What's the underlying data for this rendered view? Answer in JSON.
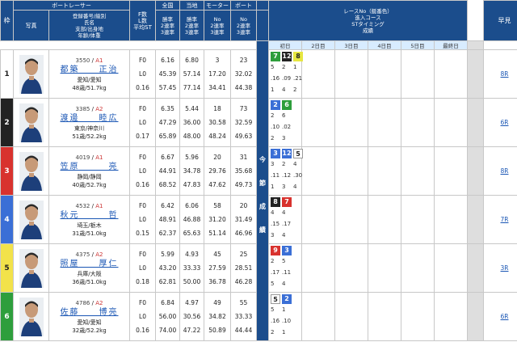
{
  "header": {
    "lane": "枠",
    "photo": "写真",
    "racer": "ボートレーサー",
    "info_lines": [
      "登録番号/級別",
      "氏名",
      "支部/出身地",
      "年齢/体重"
    ],
    "f_l_st": [
      "F数",
      "L数",
      "平均ST"
    ],
    "zenkoku": "全国",
    "touchi": "当地",
    "motor": "モーター",
    "boat": "ボート",
    "rates": [
      "勝率",
      "2連率",
      "3連率"
    ],
    "motor_sub": [
      "No",
      "2連率",
      "3連率"
    ],
    "race_title": [
      "レースNo（艇番色）",
      "進入コース",
      "STタイミング",
      "成績"
    ],
    "days": [
      "初日",
      "2日目",
      "3日目",
      "4日目",
      "5日目",
      "最終日"
    ],
    "haya": "早見",
    "konsetsu": [
      "今",
      "節",
      "成",
      "績"
    ]
  },
  "racers": [
    {
      "lane": "1",
      "lane_color": "#ffffff",
      "lane_text": "#222222",
      "reg": "3550",
      "cls": "A1",
      "name": "都築　　正治",
      "branch": "愛知/愛知",
      "age": "48歳/51.7kg",
      "f": "F0",
      "l": "L0",
      "st": "0.16",
      "zen": [
        "6.16",
        "45.39",
        "57.45"
      ],
      "tou": [
        "6.80",
        "57.14",
        "77.14"
      ],
      "mot": [
        "3",
        "17.20",
        "34.41"
      ],
      "boat": [
        "23",
        "32.02",
        "44.38"
      ],
      "d1": {
        "no": "7",
        "no_color": "#2e9e3c",
        "no_text": "#ffffff",
        "c2": "12",
        "c2_color": "#222222",
        "c2_text": "#ffffff",
        "c3": "8",
        "c3_color": "#e6e640",
        "c3_text": "#222222",
        "lines": [
          "5",
          ".16",
          "1"
        ],
        "l2": [
          "2",
          ".09",
          "4"
        ],
        "l3": [
          "1",
          ".21",
          "2"
        ]
      },
      "d2": null,
      "haya": "8R"
    },
    {
      "lane": "2",
      "lane_color": "#222222",
      "lane_text": "#ffffff",
      "reg": "3385",
      "cls": "A2",
      "name": "渡邊　　睦広",
      "branch": "東京/神奈川",
      "age": "51歳/52.2kg",
      "f": "F0",
      "l": "L0",
      "st": "0.17",
      "zen": [
        "6.35",
        "47.29",
        "65.89"
      ],
      "tou": [
        "5.44",
        "36.00",
        "48.00"
      ],
      "mot": [
        "18",
        "30.58",
        "48.24"
      ],
      "boat": [
        "73",
        "32.59",
        "49.63"
      ],
      "d1": {
        "no": "2",
        "no_color": "#3b6fd6",
        "no_text": "#ffffff",
        "c2": "6",
        "c2_color": "#2e9e3c",
        "c2_text": "#ffffff",
        "c3": "",
        "lines": [
          "2",
          ".10",
          "2"
        ],
        "l2": [
          "6",
          ".02",
          "3"
        ],
        "l3": [
          "",
          "",
          ""
        ]
      },
      "d2": null,
      "haya": "6R"
    },
    {
      "lane": "3",
      "lane_color": "#d8322e",
      "lane_text": "#ffffff",
      "reg": "4019",
      "cls": "A1",
      "name": "笠原　　　亮",
      "branch": "静岡/静岡",
      "age": "40歳/52.7kg",
      "f": "F0",
      "l": "L0",
      "st": "0.16",
      "zen": [
        "6.67",
        "44.91",
        "68.52"
      ],
      "tou": [
        "5.96",
        "34.78",
        "47.83"
      ],
      "mot": [
        "20",
        "29.76",
        "47.62"
      ],
      "boat": [
        "31",
        "35.68",
        "49.73"
      ],
      "d1": {
        "no": "3",
        "no_color": "#3b6fd6",
        "no_text": "#ffffff",
        "c2": "12",
        "c2_color": "#3b6fd6",
        "c2_text": "#ffffff",
        "c3": "5",
        "c3_color": "#ffffff",
        "c3_text": "#222222",
        "lines": [
          "3",
          ".11",
          "1"
        ],
        "l2": [
          "2",
          ".12",
          "3"
        ],
        "l3": [
          "4",
          ".30",
          "4"
        ]
      },
      "d2": null,
      "haya": "8R"
    },
    {
      "lane": "4",
      "lane_color": "#3b6fd6",
      "lane_text": "#ffffff",
      "reg": "4532",
      "cls": "A1",
      "name": "秋元　　　哲",
      "branch": "埼玉/栃木",
      "age": "31歳/51.0kg",
      "f": "F0",
      "l": "L0",
      "st": "0.15",
      "zen": [
        "6.42",
        "48.91",
        "62.37"
      ],
      "tou": [
        "6.06",
        "46.88",
        "65.63"
      ],
      "mot": [
        "58",
        "31.20",
        "51.14"
      ],
      "boat": [
        "20",
        "31.49",
        "46.96"
      ],
      "d1": {
        "no": "8",
        "no_color": "#222222",
        "no_text": "#ffffff",
        "c2": "7",
        "c2_color": "#d8322e",
        "c2_text": "#ffffff",
        "c3": "",
        "lines": [
          "4",
          ".15",
          "3"
        ],
        "l2": [
          "4",
          ".17",
          "4"
        ],
        "l3": [
          "",
          "",
          ""
        ]
      },
      "d2": null,
      "haya": "7R"
    },
    {
      "lane": "5",
      "lane_color": "#f2e24a",
      "lane_text": "#222222",
      "reg": "4375",
      "cls": "A2",
      "name": "照屋　　厚仁",
      "branch": "兵庫/大阪",
      "age": "36歳/51.0kg",
      "f": "F0",
      "l": "L0",
      "st": "0.18",
      "zen": [
        "5.99",
        "43.20",
        "62.81"
      ],
      "tou": [
        "4.93",
        "33.33",
        "50.00"
      ],
      "mot": [
        "45",
        "27.59",
        "36.78"
      ],
      "boat": [
        "25",
        "28.51",
        "46.28"
      ],
      "d1": {
        "no": "9",
        "no_color": "#d8322e",
        "no_text": "#ffffff",
        "c2": "3",
        "c2_color": "#3b6fd6",
        "c2_text": "#ffffff",
        "c3": "",
        "lines": [
          "2",
          ".17",
          "5"
        ],
        "l2": [
          "5",
          ".11",
          "4"
        ],
        "l3": [
          "",
          "",
          ""
        ]
      },
      "d2": null,
      "haya": "3R"
    },
    {
      "lane": "6",
      "lane_color": "#2e9e3c",
      "lane_text": "#ffffff",
      "reg": "4786",
      "cls": "A2",
      "name": "佐藤　　博亮",
      "branch": "愛知/愛知",
      "age": "32歳/52.2kg",
      "f": "F0",
      "l": "L0",
      "st": "0.16",
      "zen": [
        "6.84",
        "56.00",
        "74.00"
      ],
      "tou": [
        "4.97",
        "30.56",
        "47.22"
      ],
      "mot": [
        "49",
        "34.82",
        "50.89"
      ],
      "boat": [
        "55",
        "33.33",
        "44.44"
      ],
      "d1": {
        "no": "5",
        "no_color": "#ffffff",
        "no_text": "#222222",
        "c2": "2",
        "c2_color": "#3b6fd6",
        "c2_text": "#ffffff",
        "c3": "",
        "lines": [
          "5",
          ".16",
          "2"
        ],
        "l2": [
          "1",
          ".10",
          "1"
        ],
        "l3": [
          "",
          "",
          ""
        ]
      },
      "d2": null,
      "haya": "6R"
    }
  ]
}
